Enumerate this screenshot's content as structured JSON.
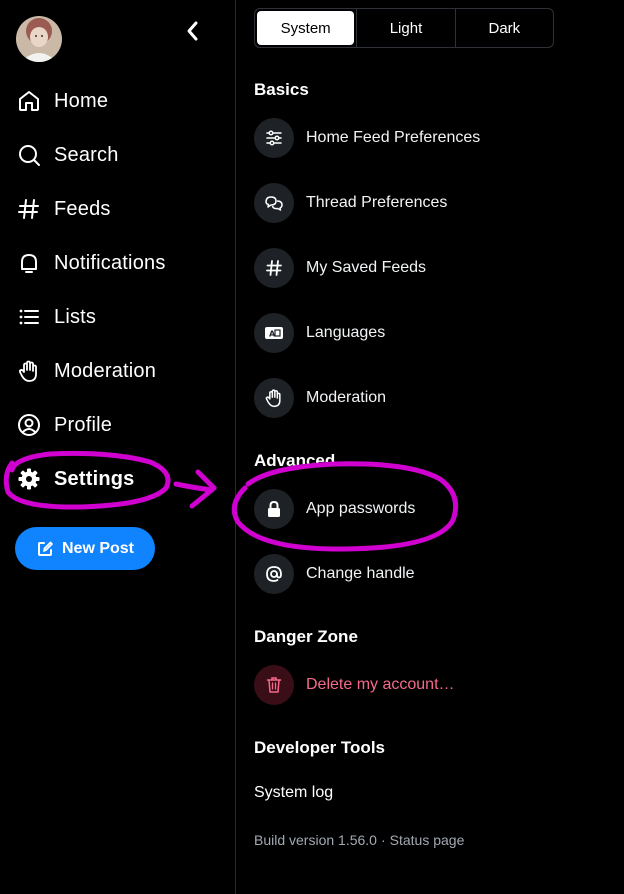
{
  "sidebar": {
    "nav": [
      {
        "label": "Home",
        "icon": "home-icon"
      },
      {
        "label": "Search",
        "icon": "search-icon"
      },
      {
        "label": "Feeds",
        "icon": "hash-icon"
      },
      {
        "label": "Notifications",
        "icon": "bell-icon"
      },
      {
        "label": "Lists",
        "icon": "list-icon"
      },
      {
        "label": "Moderation",
        "icon": "hand-icon"
      },
      {
        "label": "Profile",
        "icon": "user-circle-icon"
      },
      {
        "label": "Settings",
        "icon": "gear-icon"
      }
    ],
    "active": "Settings",
    "new_post_label": "New Post"
  },
  "theme": {
    "options": [
      "System",
      "Light",
      "Dark"
    ],
    "selected": "System"
  },
  "sections": {
    "basics": {
      "title": "Basics",
      "items": [
        {
          "label": "Home Feed Preferences",
          "icon": "sliders-icon"
        },
        {
          "label": "Thread Preferences",
          "icon": "chat-bubbles-icon"
        },
        {
          "label": "My Saved Feeds",
          "icon": "hash-icon"
        },
        {
          "label": "Languages",
          "icon": "language-icon"
        },
        {
          "label": "Moderation",
          "icon": "hand-icon"
        }
      ]
    },
    "advanced": {
      "title": "Advanced",
      "items": [
        {
          "label": "App passwords",
          "icon": "lock-icon"
        },
        {
          "label": "Change handle",
          "icon": "at-icon"
        }
      ]
    },
    "danger": {
      "title": "Danger Zone",
      "items": [
        {
          "label": "Delete my account…",
          "icon": "trash-icon"
        }
      ]
    },
    "developer": {
      "title": "Developer Tools",
      "system_log": "System log"
    }
  },
  "footer": {
    "build": "Build version 1.56.0",
    "separator": "·",
    "status": "Status page"
  },
  "colors": {
    "accent": "#1083fe",
    "annotation": "#d000d0",
    "danger": "#f56a8b"
  }
}
